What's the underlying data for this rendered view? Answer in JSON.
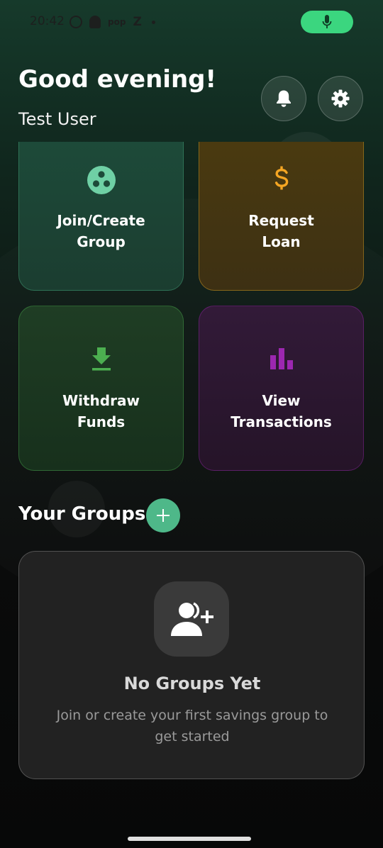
{
  "status_bar": {
    "time": "20:42",
    "app_badges": [
      "pop",
      "Z"
    ]
  },
  "header": {
    "greeting": "Good evening!",
    "username": "Test User"
  },
  "actions": [
    {
      "label": "Join/Create\nGroup",
      "icon": "group-icon",
      "color": "#6fd0a5"
    },
    {
      "label": "Request\nLoan",
      "icon": "dollar-icon",
      "color": "#f5a623"
    },
    {
      "label": "Withdraw\nFunds",
      "icon": "download-icon",
      "color": "#4caf50"
    },
    {
      "label": "View\nTransactions",
      "icon": "bar-chart-icon",
      "color": "#9c27b0"
    }
  ],
  "groups": {
    "title": "Your Groups",
    "empty_title": "No Groups Yet",
    "empty_description": "Join or create your first savings group to get started"
  },
  "colors": {
    "accent_green": "#4eb889",
    "mic_green": "#3bd67f"
  }
}
